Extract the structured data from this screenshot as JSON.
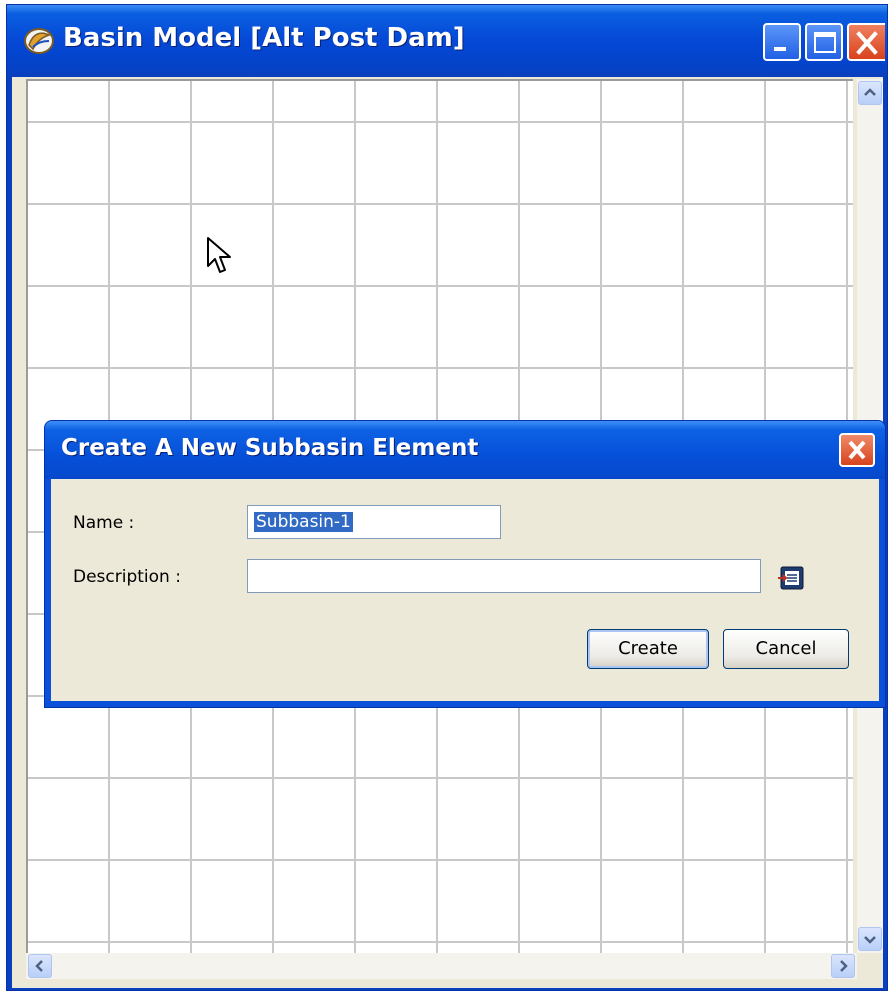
{
  "window": {
    "title": "Basin Model [Alt Post Dam]",
    "icon": "basin-model-app-icon",
    "controls": [
      "minimize-icon",
      "maximize-icon",
      "close-icon"
    ]
  },
  "canvas": {
    "grid_color": "#c8c8c8",
    "background": "#ffffff",
    "cursor": "arrow-cursor-icon"
  },
  "scrollbars": {
    "vertical": [
      "scroll-up-icon",
      "scroll-down-icon"
    ],
    "horizontal": [
      "scroll-left-icon",
      "scroll-right-icon"
    ]
  },
  "dialog": {
    "title": "Create A New Subbasin Element",
    "name_label": "Name :",
    "name_value": "Subbasin-1",
    "description_label": "Description :",
    "description_value": "",
    "description_editor_icon": "text-editor-icon",
    "create_label": "Create",
    "cancel_label": "Cancel"
  },
  "colors": {
    "titlebar": "#0548d6",
    "dialog_face": "#ece9d8",
    "selection": "#316ac5",
    "close_button": "#d8431c"
  }
}
